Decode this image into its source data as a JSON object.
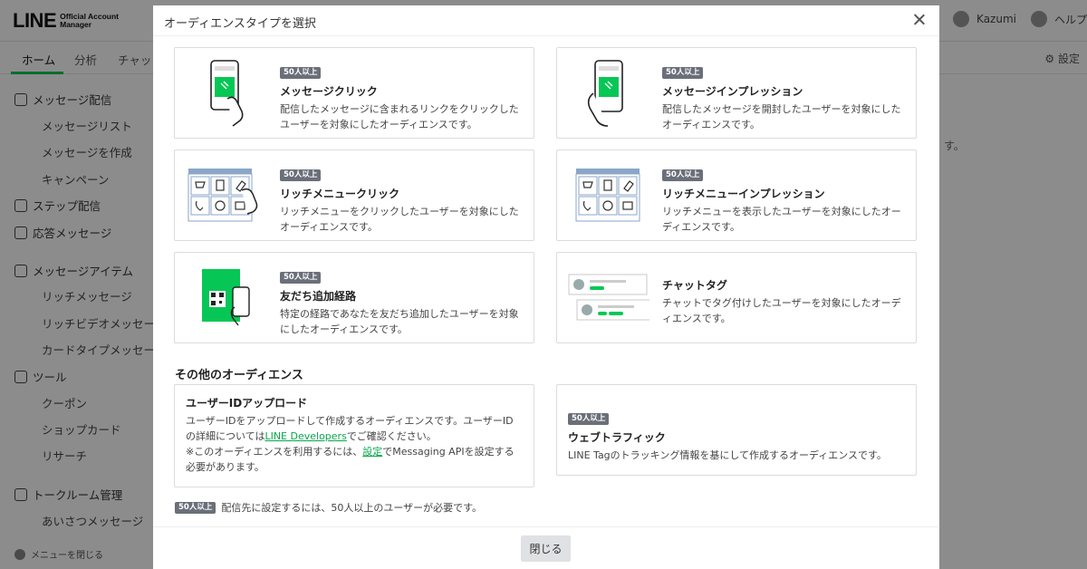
{
  "app": {
    "logo_main": "LINE",
    "logo_sub": "Official Account Manager",
    "user_name": "Kazumi",
    "help_label": "ヘルプ",
    "tabs": [
      "ホーム",
      "分析",
      "チャット"
    ],
    "settings_label": "設定",
    "background_fragment": "す。",
    "sidebar": {
      "items": [
        {
          "label": "メッセージ配信",
          "sub": false,
          "icon": "message-broadcast-icon"
        },
        {
          "label": "メッセージリスト",
          "sub": true
        },
        {
          "label": "メッセージを作成",
          "sub": true
        },
        {
          "label": "キャンペーン",
          "sub": true
        },
        {
          "label": "ステップ配信",
          "sub": false,
          "icon": "step-icon"
        },
        {
          "label": "応答メッセージ",
          "sub": false,
          "icon": "reply-icon"
        },
        {
          "label": "メッセージアイテム",
          "sub": false,
          "icon": "message-item-icon"
        },
        {
          "label": "リッチメッセージ",
          "sub": true
        },
        {
          "label": "リッチビデオメッセージ",
          "sub": true
        },
        {
          "label": "カードタイプメッセージ",
          "sub": true
        },
        {
          "label": "ツール",
          "sub": false,
          "icon": "store-icon"
        },
        {
          "label": "クーポン",
          "sub": true
        },
        {
          "label": "ショップカード",
          "sub": true
        },
        {
          "label": "リサーチ",
          "sub": true
        },
        {
          "label": "トークルーム管理",
          "sub": false,
          "icon": "talk-room-icon"
        },
        {
          "label": "あいさつメッセージ",
          "sub": true
        }
      ],
      "collapse_label": "メニューを閉じる"
    }
  },
  "modal": {
    "title": "オーディエンスタイプを選択",
    "badge_label": "50人以上",
    "cards": [
      {
        "title": "メッセージクリック",
        "desc": "配信したメッセージに含まれるリンクをクリックしたユーザーを対象にしたオーディエンスです。",
        "badge": true,
        "illustration": "phone-tap-icon"
      },
      {
        "title": "メッセージインプレッション",
        "desc": "配信したメッセージを開封したユーザーを対象にしたオーディエンスです。",
        "badge": true,
        "illustration": "phone-hold-icon"
      },
      {
        "title": "リッチメニュークリック",
        "desc": "リッチメニューをクリックしたユーザーを対象にしたオーディエンスです。",
        "badge": true,
        "illustration": "richmenu-tap-icon"
      },
      {
        "title": "リッチメニューインプレッション",
        "desc": "リッチメニューを表示したユーザーを対象にしたオーディエンスです。",
        "badge": true,
        "illustration": "richmenu-icon"
      },
      {
        "title": "友だち追加経路",
        "desc": "特定の経路であなたを友だち追加したユーザーを対象にしたオーディエンスです。",
        "badge": true,
        "illustration": "qr-phone-icon"
      },
      {
        "title": "チャットタグ",
        "desc": "チャットでタグ付けしたユーザーを対象にしたオーディエンスです。",
        "badge": false,
        "illustration": "chat-tag-icon"
      }
    ],
    "other_section_title": "その他のオーディエンス",
    "upload": {
      "title": "ユーザーIDアップロード",
      "line1": "ユーザーIDをアップロードして作成するオーディエンスです。ユーザーIDの詳細については",
      "link1": "LINE Developers",
      "line1_after": "でご確認ください。",
      "line2": "※このオーディエンスを利用するには、",
      "link2": "設定",
      "line2_after": "でMessaging APIを設定する必要があります。"
    },
    "web_traffic": {
      "title": "ウェブトラフィック",
      "desc": "LINE Tagのトラッキング情報を基にして作成するオーディエンスです。"
    },
    "footnote": "配信先に設定するには、50人以上のユーザーが必要です。",
    "close_button": "閉じる"
  },
  "colors": {
    "accent": "#06c755",
    "badge": "#6a6f79",
    "overlay": "rgba(0,0,0,0.45)"
  }
}
